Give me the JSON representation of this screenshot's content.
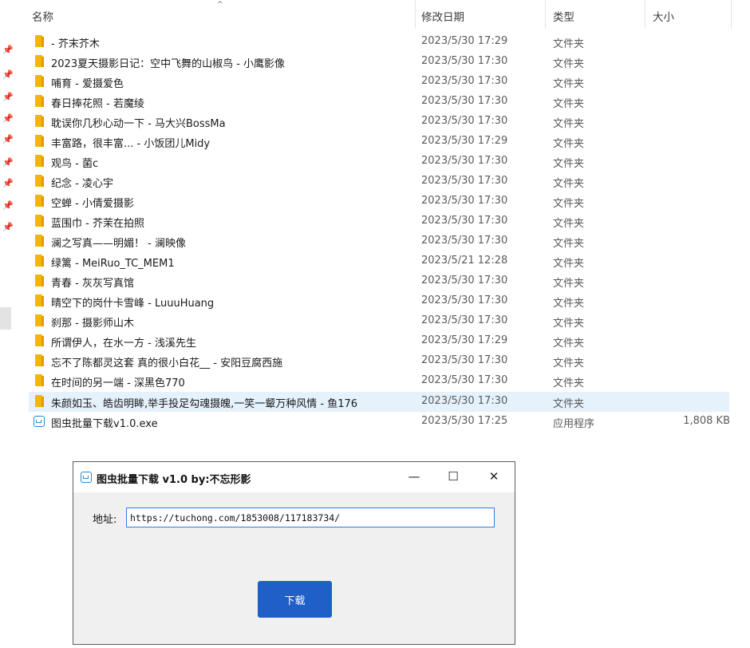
{
  "header": {
    "sort_indicator": "^",
    "columns": {
      "name": "名称",
      "date": "修改日期",
      "type": "类型",
      "size": "大小"
    }
  },
  "rows": [
    {
      "name": "- 芥末芥木",
      "date": "2023/5/30 17:29",
      "type": "文件夹",
      "size": "",
      "icon": "folder-icon"
    },
    {
      "name": "2023夏天摄影日记：空中飞舞的山椒鸟 - 小鹰影像",
      "date": "2023/5/30 17:30",
      "type": "文件夹",
      "size": "",
      "icon": "folder-icon"
    },
    {
      "name": "哺育 - 爱摄爱色",
      "date": "2023/5/30 17:30",
      "type": "文件夹",
      "size": "",
      "icon": "folder-icon"
    },
    {
      "name": "春日捧花照 - 若魔绫",
      "date": "2023/5/30 17:30",
      "type": "文件夹",
      "size": "",
      "icon": "folder-icon"
    },
    {
      "name": "耽误你几秒心动一下 - 马大兴BossMa",
      "date": "2023/5/30 17:30",
      "type": "文件夹",
      "size": "",
      "icon": "folder-icon"
    },
    {
      "name": "丰富路，很丰富... - 小饭团儿Midy",
      "date": "2023/5/30 17:29",
      "type": "文件夹",
      "size": "",
      "icon": "folder-icon"
    },
    {
      "name": "观鸟 - 菌c",
      "date": "2023/5/30 17:30",
      "type": "文件夹",
      "size": "",
      "icon": "folder-icon"
    },
    {
      "name": "纪念 - 凌心宇",
      "date": "2023/5/30 17:30",
      "type": "文件夹",
      "size": "",
      "icon": "folder-icon"
    },
    {
      "name": "空蝉 - 小倩爱摄影",
      "date": "2023/5/30 17:30",
      "type": "文件夹",
      "size": "",
      "icon": "folder-icon"
    },
    {
      "name": "蓝围巾 - 芥茉在拍照",
      "date": "2023/5/30 17:30",
      "type": "文件夹",
      "size": "",
      "icon": "folder-icon"
    },
    {
      "name": "澜之写真——明媚！ - 澜映像",
      "date": "2023/5/30 17:30",
      "type": "文件夹",
      "size": "",
      "icon": "folder-icon"
    },
    {
      "name": "绿篱 - MeiRuo_TC_MEM1",
      "date": "2023/5/21 12:28",
      "type": "文件夹",
      "size": "",
      "icon": "folder-icon"
    },
    {
      "name": "青春 - 灰灰写真馆",
      "date": "2023/5/30 17:30",
      "type": "文件夹",
      "size": "",
      "icon": "folder-icon"
    },
    {
      "name": "晴空下的岗什卡雪峰 - LuuuHuang",
      "date": "2023/5/30 17:30",
      "type": "文件夹",
      "size": "",
      "icon": "folder-icon"
    },
    {
      "name": "刹那 - 摄影师山木",
      "date": "2023/5/30 17:30",
      "type": "文件夹",
      "size": "",
      "icon": "folder-icon"
    },
    {
      "name": "所谓伊人，在水一方 - 浅溪先生",
      "date": "2023/5/30 17:29",
      "type": "文件夹",
      "size": "",
      "icon": "folder-icon"
    },
    {
      "name": "忘不了陈都灵这套 真的很小白花__ - 安阳豆腐西施",
      "date": "2023/5/30 17:30",
      "type": "文件夹",
      "size": "",
      "icon": "folder-icon"
    },
    {
      "name": "在时间的另一端 - 深黑色770",
      "date": "2023/5/30 17:30",
      "type": "文件夹",
      "size": "",
      "icon": "folder-icon"
    },
    {
      "name": "朱颜如玉、皓齿明眸,举手投足勾魂摄魄,一笑一颦万种风情 - 鱼176",
      "date": "2023/5/30 17:30",
      "type": "文件夹",
      "size": "",
      "icon": "folder-icon",
      "selected": true
    },
    {
      "name": "图虫批量下载v1.0.exe",
      "date": "2023/5/30 17:25",
      "type": "应用程序",
      "size": "1,808 KB",
      "icon": "app-icon"
    }
  ],
  "dialog": {
    "title": "图虫批量下载 v1.0   by:不忘形影",
    "minimize": "—",
    "maximize": "☐",
    "close": "✕",
    "address_label": "地址:",
    "address_value": "https://tuchong.com/1853008/117183734/",
    "download_label": "下载"
  },
  "colors": {
    "selection": "#e5f1fb",
    "folder": "#f2b705",
    "accent": "#1f5fc8"
  }
}
